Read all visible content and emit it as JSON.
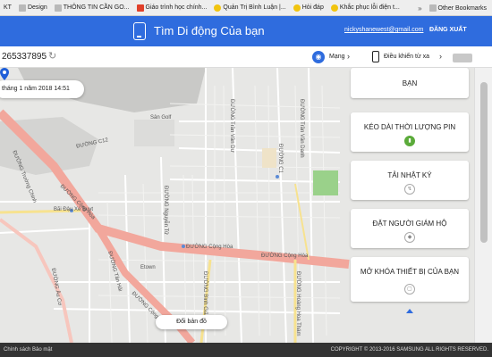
{
  "bookmarks": {
    "items": [
      {
        "label": "KT",
        "icon": "bookmark-icon"
      },
      {
        "label": "Design",
        "icon": "folder-icon"
      },
      {
        "label": "THÔNG TIN CẦN GO...",
        "icon": "folder-icon"
      },
      {
        "label": "Giáo trình học chính...",
        "icon": "bookmark-icon"
      },
      {
        "label": "Quản Trị Bình Luận |...",
        "icon": "bookmark-icon"
      },
      {
        "label": "Hỏi đáp",
        "icon": "bookmark-icon"
      },
      {
        "label": "Khắc phục lỗi điện t...",
        "icon": "bookmark-icon"
      }
    ],
    "other": "Other Bookmarks"
  },
  "header": {
    "title": "Tìm Di động Của bạn",
    "email": "nickyshanewest@gmail.com",
    "logout": "ĐĂNG XUẤT",
    "color": "#2f6cde"
  },
  "toolbar": {
    "phone_number": "265337895",
    "network_label": "Mạng",
    "remote_label": "Điều khiển từ xa"
  },
  "map": {
    "date": "tháng 1 năm 2018 14:51",
    "change_map": "Đổi bản đồ",
    "labels": {
      "cong_hoa_1": "ĐƯỜNG Cộng Hòa",
      "cong_hoa_2": "ĐƯỜNG Cộng Hòa",
      "cong_hoa_3": "ĐƯỜNG Cộng Hòa",
      "cong_hoa_4": "ĐƯỜNG Cộng Hòa",
      "truong_chinh": "ĐƯỜNG Trường Chinh",
      "san_golf": "Sân Golf",
      "c12": "ĐƯỜNG C12",
      "bai_dau": "Bãi Đậu Xe Buyt",
      "tan_hai": "ĐƯỜNG Tân Hải",
      "au_co": "ĐƯỜNG Âu Cơ",
      "binh_gia": "ĐƯỜNG Bình Giã",
      "hoang_hoa_tham": "ĐƯỜNG Hoàng Hoa Thám",
      "etown": "Etown",
      "nguyen_tu": "ĐƯỜNG Nguyễn Tử",
      "c1": "ĐƯỜNG C1",
      "tran_van_du": "ĐƯỜNG Trần Văn Dư",
      "tran_van_danh": "ĐƯỜNG Trần Văn Danh"
    }
  },
  "panel": {
    "cards": [
      {
        "label": "BẠN"
      },
      {
        "label": "KÉO DÀI THỜI LƯỢNG PIN"
      },
      {
        "label": "TẢI NHẬT KÝ"
      },
      {
        "label": "ĐẶT NGƯỜI GIÁM HỘ"
      },
      {
        "label": "MỞ KHÓA THIẾT BỊ CỦA BẠN"
      }
    ]
  },
  "footer": {
    "privacy": "Chính sách Bảo mật",
    "copyright": "COPYRIGHT © 2013-2016 SAMSUNG ALL RIGHTS RESERVED."
  }
}
